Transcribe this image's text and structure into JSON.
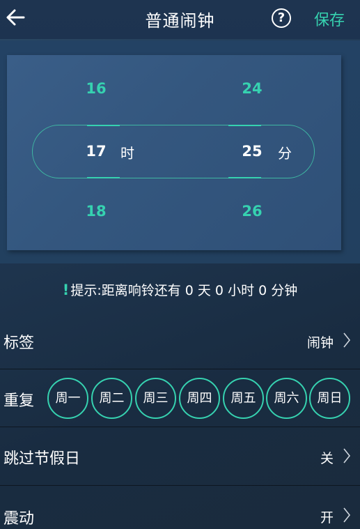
{
  "header": {
    "title": "普通闹钟",
    "help_label": "?",
    "save_label": "保存"
  },
  "picker": {
    "hours": {
      "prev": "16",
      "selected": "17",
      "next": "18",
      "unit": "时"
    },
    "minutes": {
      "prev": "24",
      "selected": "25",
      "next": "26",
      "unit": "分"
    }
  },
  "hint": {
    "text": "提示:距离响铃还有 0 天 0 小时 0 分钟"
  },
  "settings": {
    "label_row": {
      "label": "标签",
      "value": "闹钟"
    },
    "repeat_row": {
      "label": "重复",
      "days": [
        "周一",
        "周二",
        "周三",
        "周四",
        "周五",
        "周六",
        "周日"
      ]
    },
    "holiday_row": {
      "label": "跳过节假日",
      "value": "关"
    },
    "vibrate_row": {
      "label": "震动",
      "value": "开"
    }
  },
  "colors": {
    "accent": "#36d2b0",
    "background": "#1f3650",
    "card": "#34577f"
  }
}
